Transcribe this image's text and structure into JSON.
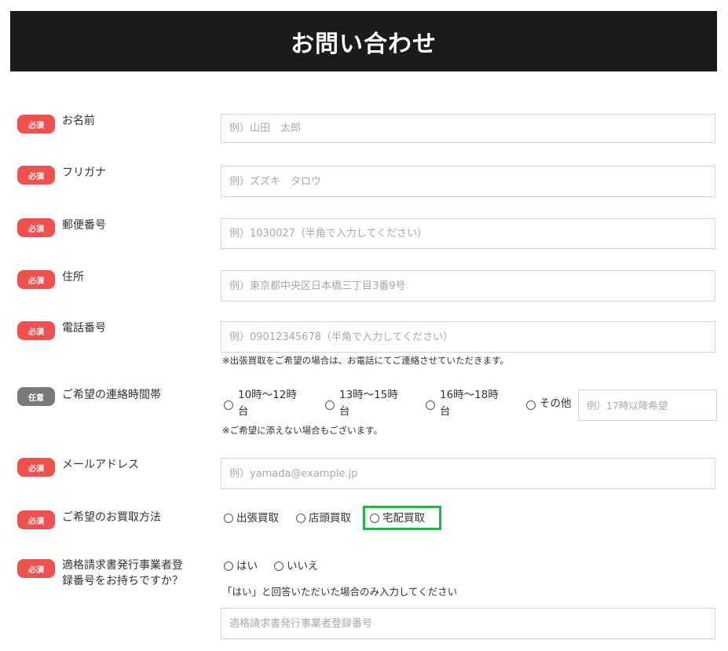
{
  "header": {
    "title": "お問い合わせ"
  },
  "badges": {
    "required": "必須",
    "optional": "任意"
  },
  "fields": {
    "name": {
      "label": "お名前",
      "placeholder": "例）山田　太郎"
    },
    "furigana": {
      "label": "フリガナ",
      "placeholder": "例）ズズキ　タロウ"
    },
    "postal": {
      "label": "郵便番号",
      "placeholder": "例）1030027（半角で入力してください）"
    },
    "address": {
      "label": "住所",
      "placeholder": "例）東京都中央区日本橋三丁目3番9号"
    },
    "phone": {
      "label": "電話番号",
      "placeholder": "例）09012345678（半角で入力してください）",
      "note": "※出張買取をご希望の場合は、お電話にてご連絡させていただきます。"
    },
    "contact_time": {
      "label": "ご希望の連絡時間帯",
      "options": [
        {
          "line1": "10時～12時",
          "line2": "台"
        },
        {
          "line1": "13時～15時",
          "line2": "台"
        },
        {
          "line1": "16時～18時",
          "line2": "台"
        },
        {
          "line1": "その他",
          "line2": ""
        }
      ],
      "other_placeholder": "例）17時以降希望",
      "note": "※ご希望に添えない場合もございます。"
    },
    "email": {
      "label": "メールアドレス",
      "placeholder": "例）yamada@example.jp"
    },
    "purchase_method": {
      "label": "ご希望のお買取方法",
      "options": [
        "出張買取",
        "店頭買取",
        "宅配買取"
      ]
    },
    "invoice": {
      "label_line1": "適格請求書発行事業者登",
      "label_line2": "録番号をお持ちですか？",
      "options": [
        "はい",
        "いいえ"
      ],
      "note": "「はい」と回答いただいた場合のみ入力してください",
      "placeholder": "適格請求書発行事業者登録番号"
    }
  },
  "colors": {
    "header_bg": "#1c1b1b",
    "required_badge": "#f0504e",
    "optional_badge": "#7a7a7a",
    "highlight": "#2db04b"
  }
}
